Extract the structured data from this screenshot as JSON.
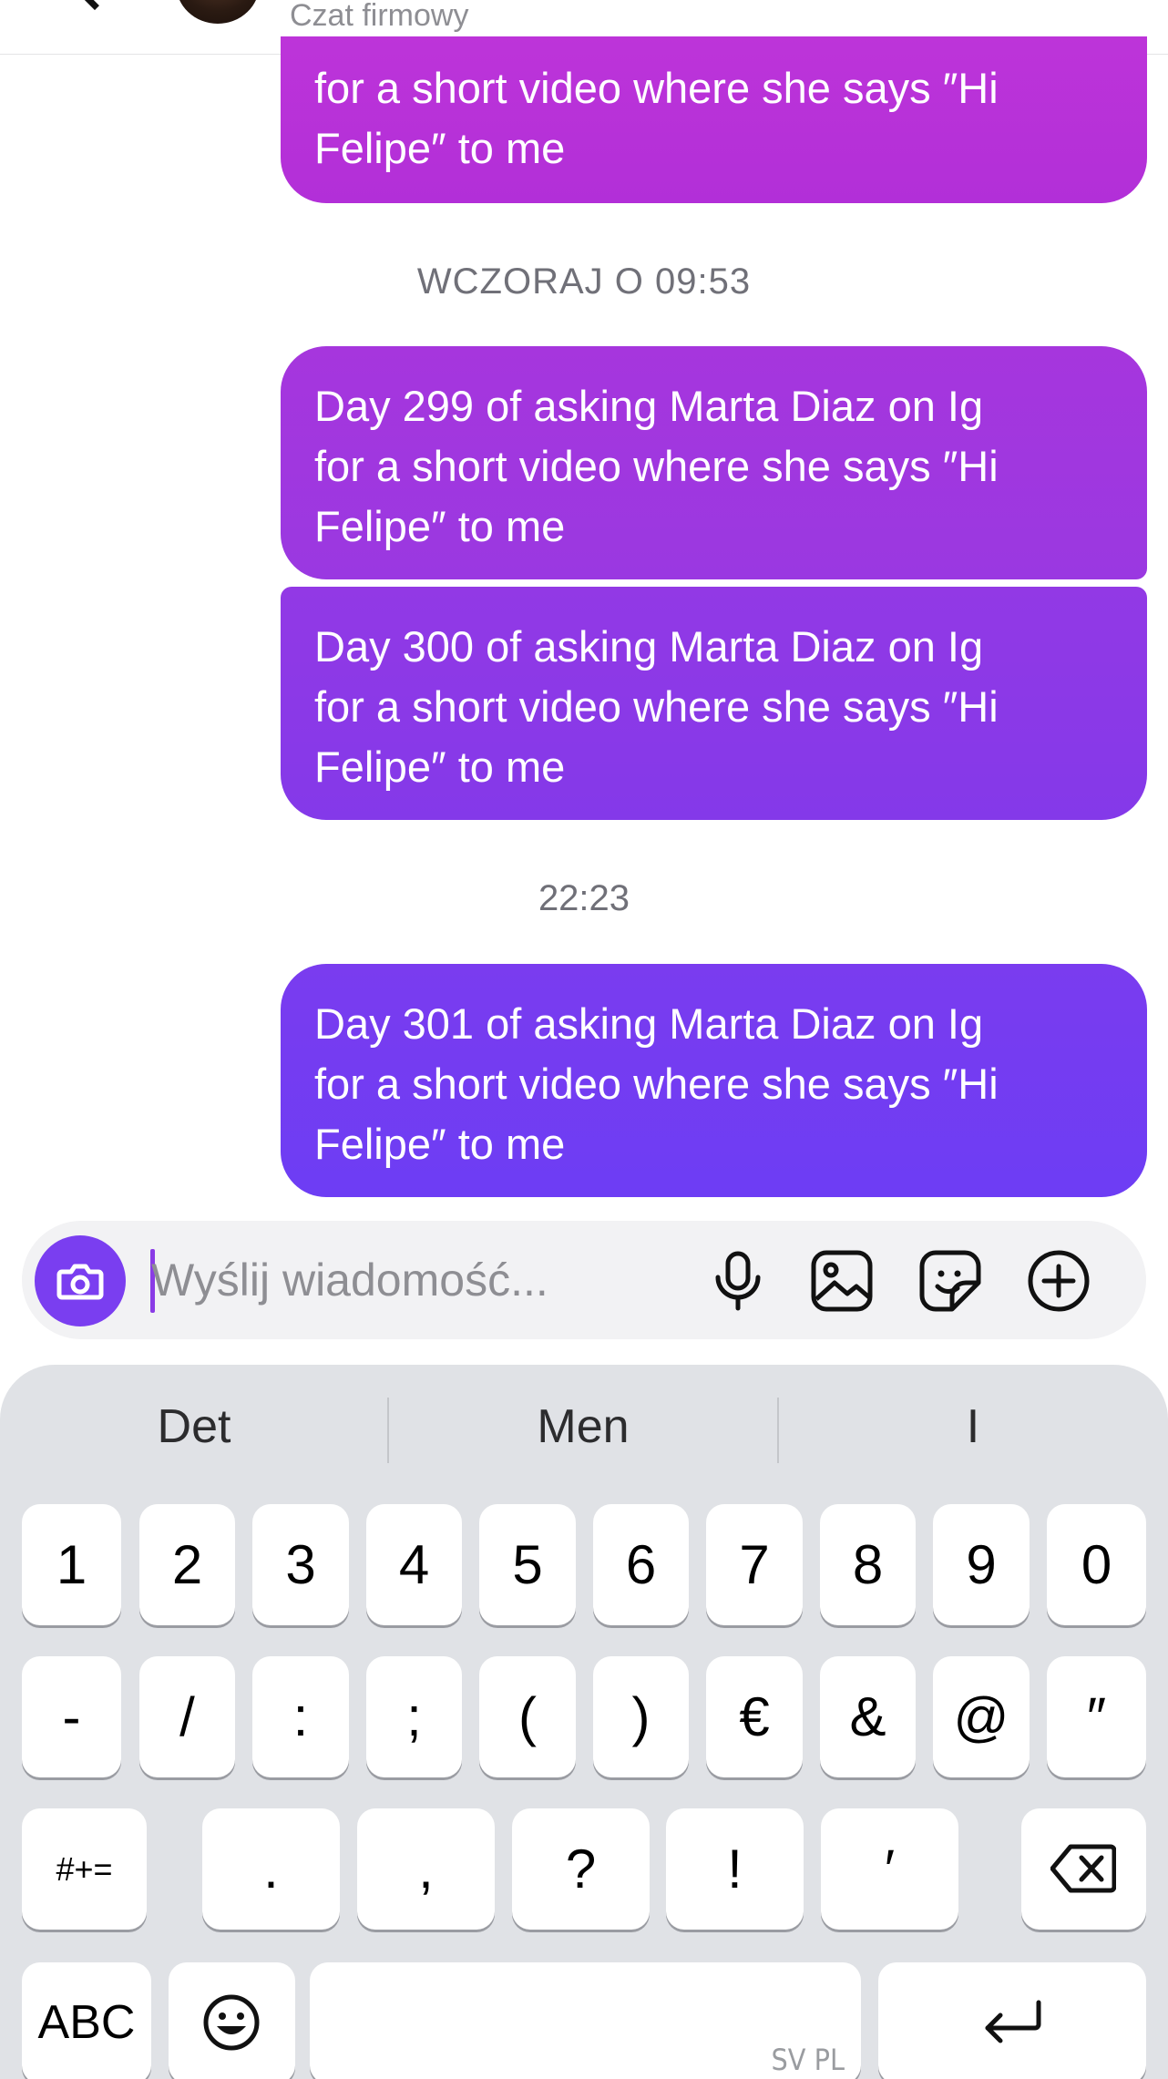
{
  "header": {
    "subtitle": "Czat firmowy"
  },
  "messages": [
    {
      "text": "for a short video where she says ″Hi\nFelipe″ to me"
    },
    {
      "text": "Day 299 of asking Marta Diaz on Ig\nfor a short video where she says ″Hi\nFelipe″ to me"
    },
    {
      "text": "Day 300 of asking Marta Diaz on Ig\nfor a short video where she says ″Hi\nFelipe″ to me"
    },
    {
      "text": "Day 301 of asking Marta Diaz on Ig\nfor a short video where she says ″Hi\nFelipe″ to me"
    }
  ],
  "timestamps": [
    "WCZORAJ O 09:53",
    "22:23"
  ],
  "composer": {
    "placeholder": "Wyślij wiadomość...",
    "icons": [
      "camera-icon",
      "microphone-icon",
      "gallery-icon",
      "sticker-icon",
      "plus-icon"
    ],
    "accent": "#7a3ef0"
  },
  "keyboard": {
    "suggestions": [
      "Det",
      "Men",
      "I"
    ],
    "row1": [
      "1",
      "2",
      "3",
      "4",
      "5",
      "6",
      "7",
      "8",
      "9",
      "0"
    ],
    "row2": [
      "-",
      "/",
      ":",
      ";",
      "(",
      ")",
      "€",
      "&",
      "@",
      "″"
    ],
    "row3": [
      "#+=",
      ".",
      ",",
      "?",
      "!",
      "′",
      "backspace-icon"
    ],
    "row4": [
      "ABC",
      "emoji-icon",
      "SV PL",
      "return-icon"
    ]
  }
}
